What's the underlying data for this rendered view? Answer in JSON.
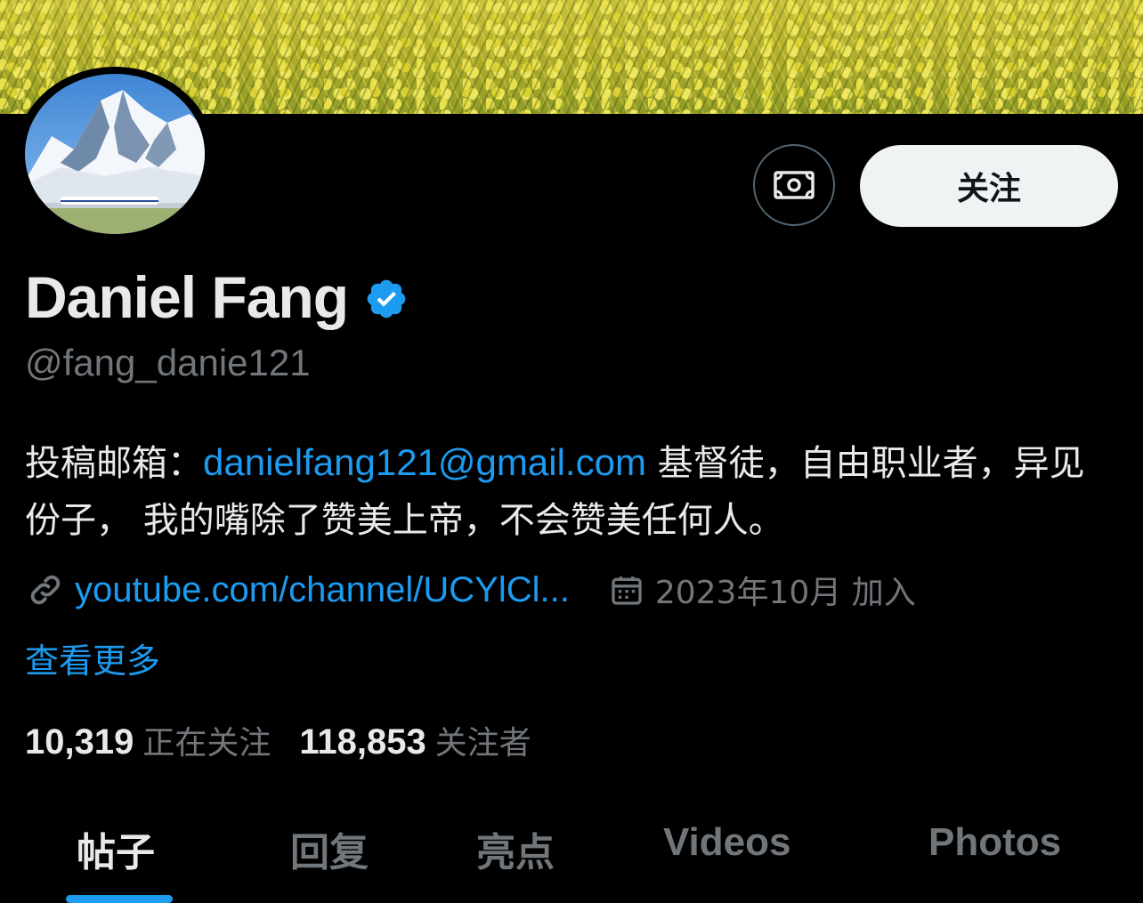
{
  "profile": {
    "name": "Daniel Fang",
    "handle": "@fang_danie121",
    "bio_prefix": "投稿邮箱：",
    "bio_email": "danielfang121@gmail.com",
    "bio_suffix": " 基督徒，自由职业者，异见份子， 我的嘴除了赞美上帝，不会赞美任何人。",
    "website": "youtube.com/channel/UCYlCl...",
    "joined": "2023年10月 加入",
    "see_more": "查看更多"
  },
  "actions": {
    "follow_label": "关注",
    "money_icon": "money-icon"
  },
  "stats": {
    "following_count": "10,319",
    "following_label": "正在关注",
    "followers_count": "118,853",
    "followers_label": "关注者"
  },
  "tabs": [
    {
      "label": "帖子",
      "active": true
    },
    {
      "label": "回复",
      "active": false
    },
    {
      "label": "亮点",
      "active": false
    },
    {
      "label": "Videos",
      "active": false
    },
    {
      "label": "Photos",
      "active": false
    }
  ],
  "colors": {
    "accent": "#1d9bf0",
    "background": "#000000",
    "muted_text": "#71767b",
    "primary_text": "#e7e9ea",
    "follow_button_bg": "#eff3f4"
  }
}
